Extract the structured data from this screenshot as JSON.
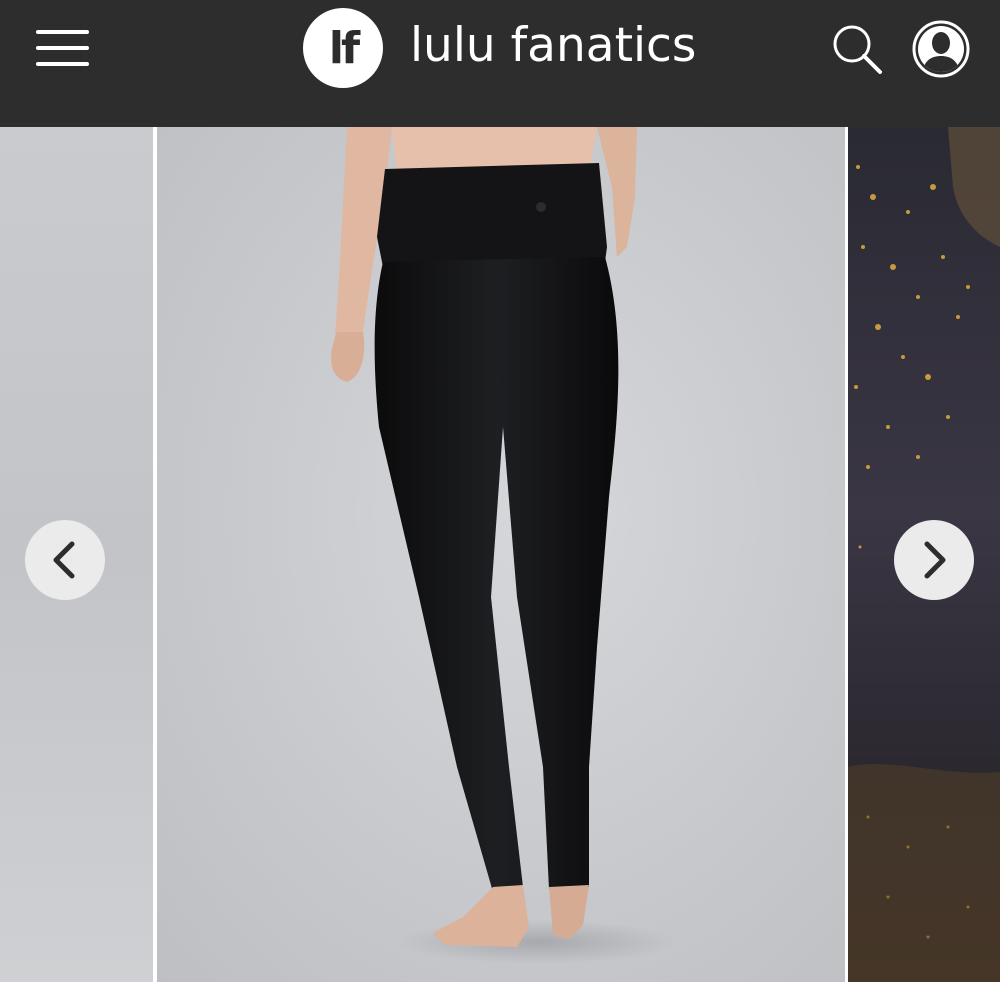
{
  "header": {
    "logo_text": "lf",
    "brand_name": "lulu fanatics",
    "menu_icon": "hamburger-menu-icon",
    "search_icon": "search-icon",
    "account_icon": "user-account-icon",
    "background_color": "#2d2d2d",
    "text_color": "#ffffff"
  },
  "carousel": {
    "prev_icon": "chevron-left-icon",
    "next_icon": "chevron-right-icon",
    "arrow_button_color": "#ebebeb"
  }
}
